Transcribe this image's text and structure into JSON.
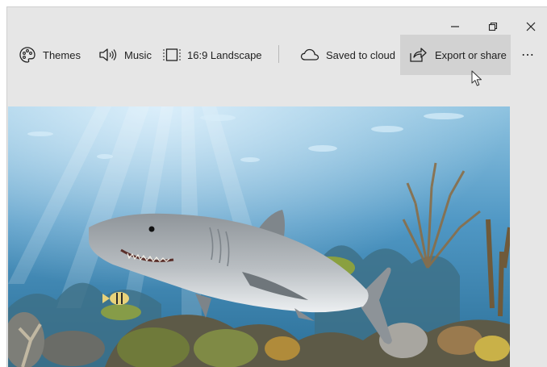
{
  "window_controls": {
    "minimize_icon": "minimize-icon",
    "restore_icon": "restore-icon",
    "close_icon": "close-icon"
  },
  "toolbar": {
    "themes_label": "Themes",
    "music_label": "Music",
    "aspect_label": "16:9 Landscape",
    "cloud_label": "Saved to cloud",
    "export_label": "Export or share",
    "more_label": "⋯"
  },
  "colors": {
    "window_bg": "#e6e6e6",
    "highlight": "#d2d2d2",
    "water_top": "#8fc3e0",
    "water_bottom": "#2b6f97"
  }
}
